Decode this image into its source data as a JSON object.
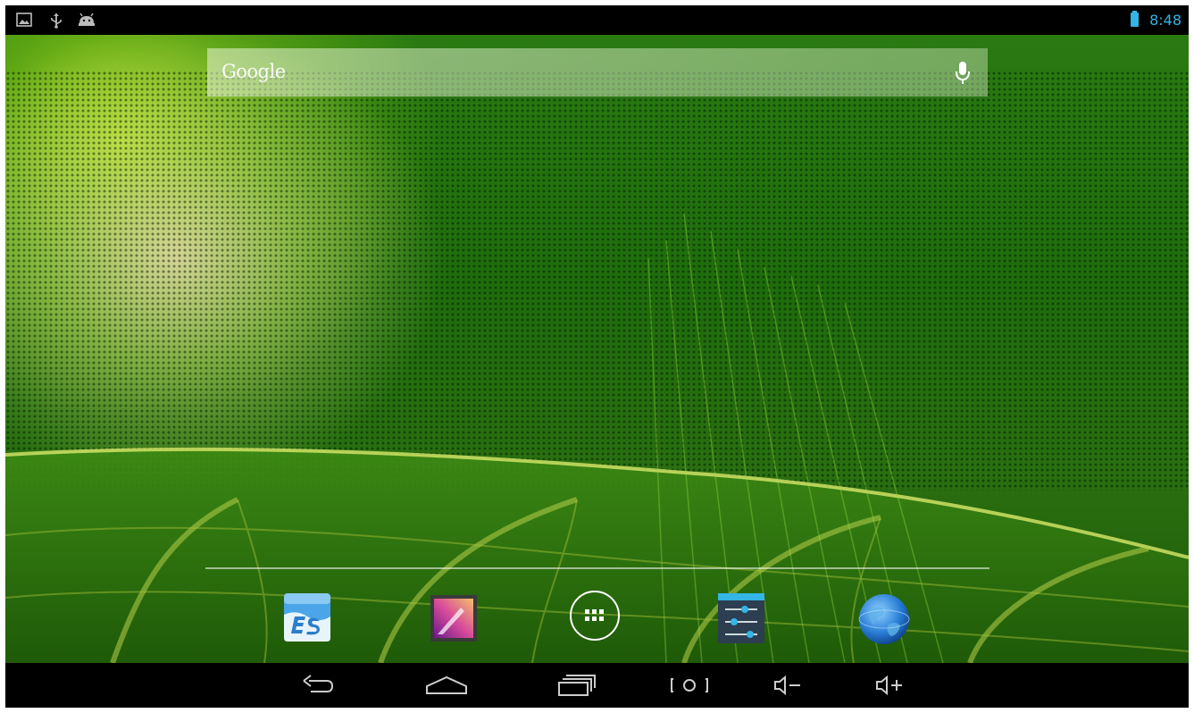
{
  "status_bar": {
    "notification_icons": [
      "picture-icon",
      "usb-icon",
      "android-debug-icon"
    ],
    "battery_icon": "battery-icon",
    "time": "8:48",
    "accent_color": "#33b5e5"
  },
  "search": {
    "label": "Google",
    "mic_icon": "microphone-icon"
  },
  "dock": {
    "items": [
      {
        "icon": "es-file-explorer-icon"
      },
      {
        "icon": "gallery-icon"
      },
      {
        "icon": "all-apps-icon"
      },
      {
        "icon": "settings-icon"
      },
      {
        "icon": "browser-globe-icon"
      }
    ]
  },
  "navigation_bar": {
    "buttons": [
      "back-icon",
      "home-icon",
      "recent-apps-icon",
      "screenshot-icon",
      "volume-down-icon",
      "volume-up-icon"
    ]
  }
}
